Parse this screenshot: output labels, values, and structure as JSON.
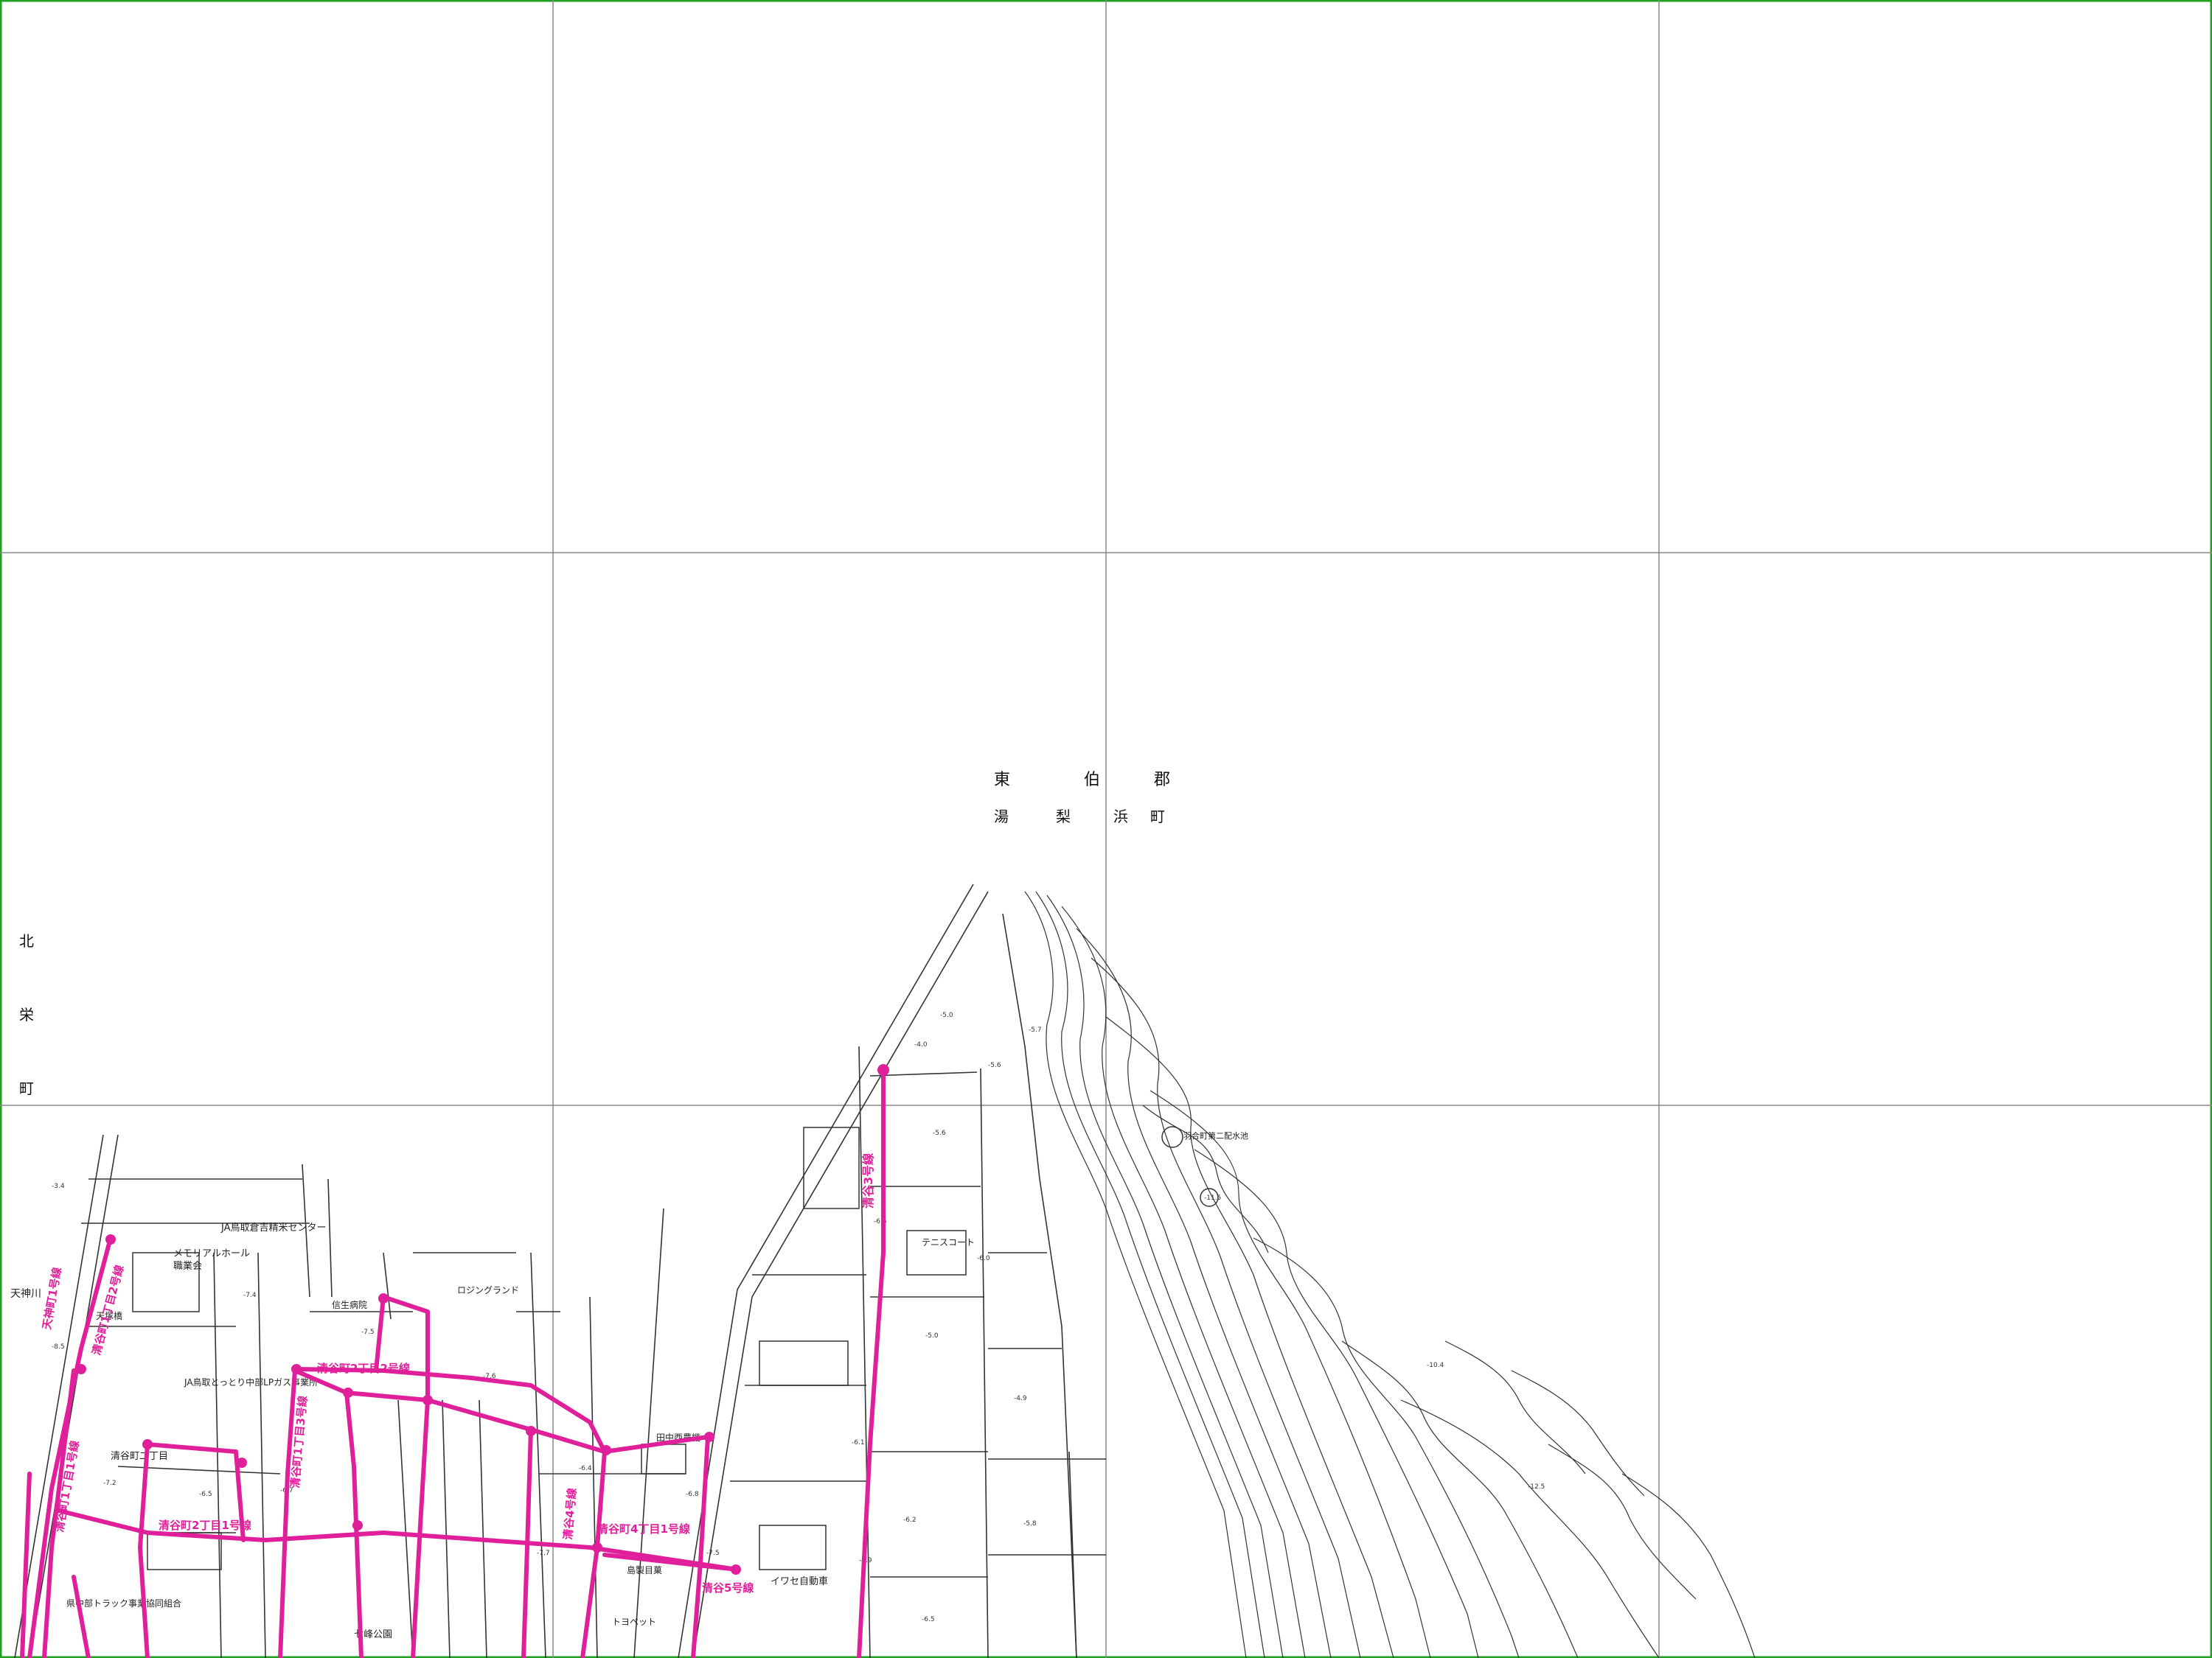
{
  "map": {
    "district_labels": {
      "county": [
        "東",
        "伯",
        "郡"
      ],
      "town": [
        "湯",
        "梨",
        "浜",
        "町"
      ],
      "west_town": [
        "北",
        "栄",
        "町"
      ]
    },
    "place_labels": [
      {
        "id": "memorial",
        "text": "メモリアルホール"
      },
      {
        "id": "ceremony",
        "text": "職業会"
      },
      {
        "id": "ja-center",
        "text": "JA鳥取倉吉精米センター"
      },
      {
        "id": "kiyoya-park",
        "text": "七峰公園"
      },
      {
        "id": "tennis",
        "text": "テニスコート"
      },
      {
        "id": "iwase",
        "text": "イワセ自動車"
      },
      {
        "id": "truck",
        "text": "県中部トラック事業協同組合"
      },
      {
        "id": "kiyoya-town",
        "text": "清谷町二丁目"
      },
      {
        "id": "river",
        "text": "天神川"
      },
      {
        "id": "gas",
        "text": "JA鳥取とっとり中部LPガス事業所"
      },
      {
        "id": "hospital",
        "text": "信生病院"
      },
      {
        "id": "tanaka",
        "text": "田中西農機"
      },
      {
        "id": "shrine",
        "text": "羽合町第二配水池"
      },
      {
        "id": "toyopet",
        "text": "トヨペット"
      },
      {
        "id": "shop",
        "text": "島製目菓"
      },
      {
        "id": "ground",
        "text": "ロジングランド"
      },
      {
        "id": "bridge",
        "text": "天塚橋"
      }
    ],
    "elevations": [
      "-5.0",
      "-5.6",
      "-5.6",
      "-6.5",
      "-6.0",
      "-5.0",
      "-4.9",
      "-7.4",
      "-7.6",
      "-7.5",
      "-6.5",
      "-6.7",
      "-7.7",
      "-7.2",
      "-7.5",
      "-6.4",
      "-6.1",
      "-5.7",
      "-5.8",
      "-6.2",
      "-4.9",
      "-6.5",
      "-4.0",
      "-3.4",
      "-8.5",
      "-6.8",
      "-10.4",
      "-12.5",
      "-11.5"
    ],
    "routes": [
      {
        "id": "r1",
        "text": "清谷3号線"
      },
      {
        "id": "r2",
        "text": "清谷町1丁目2号線"
      },
      {
        "id": "r3",
        "text": "清谷町1丁目1号線"
      },
      {
        "id": "r4",
        "text": "清谷町2丁目1号線"
      },
      {
        "id": "r5",
        "text": "清谷町2丁目2号線"
      },
      {
        "id": "r6",
        "text": "清谷町1丁目3号線"
      },
      {
        "id": "r7",
        "text": "清谷5号線"
      },
      {
        "id": "r8",
        "text": "清谷4号線"
      },
      {
        "id": "r9",
        "text": "天神町1号線"
      },
      {
        "id": "r10",
        "text": "清谷町4丁目1号線"
      }
    ],
    "colors": {
      "route": "#e0209a",
      "frame": "#22a022",
      "grid": "#8a8a8a",
      "ink": "#222222"
    }
  }
}
